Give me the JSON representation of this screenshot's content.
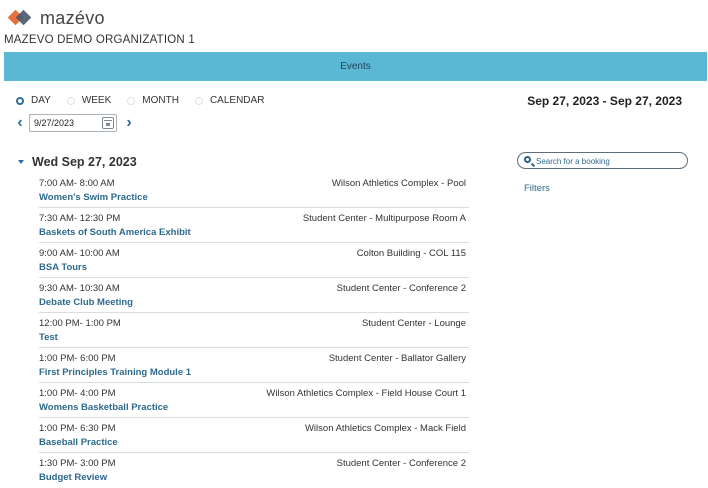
{
  "brand": {
    "name": "mazévo"
  },
  "organization": "MAZEVO DEMO ORGANIZATION 1",
  "tabs": [
    {
      "label": "Events",
      "active": true
    }
  ],
  "view_options": [
    {
      "label": "DAY",
      "selected": true
    },
    {
      "label": "WEEK",
      "selected": false
    },
    {
      "label": "MONTH",
      "selected": false
    },
    {
      "label": "CALENDAR",
      "selected": false
    }
  ],
  "date_range": "Sep 27, 2023 - Sep 27, 2023",
  "date_picker": {
    "value": "9/27/2023"
  },
  "day_header": "Wed Sep 27, 2023",
  "search": {
    "placeholder": "Search for a booking"
  },
  "filters_label": "Filters",
  "events": [
    {
      "time": "7:00 AM- 8:00 AM",
      "location": "Wilson Athletics Complex - Pool",
      "title": "Women's Swim Practice"
    },
    {
      "time": "7:30 AM- 12:30 PM",
      "location": "Student Center - Multipurpose Room A",
      "title": "Baskets of South America Exhibit"
    },
    {
      "time": "9:00 AM- 10:00 AM",
      "location": "Colton Building - COL 115",
      "title": "BSA Tours"
    },
    {
      "time": "9:30 AM- 10:30 AM",
      "location": "Student Center - Conference 2",
      "title": "Debate Club Meeting"
    },
    {
      "time": "12:00 PM- 1:00 PM",
      "location": "Student Center - Lounge",
      "title": "Test"
    },
    {
      "time": "1:00 PM- 6:00 PM",
      "location": "Student Center - Ballator Gallery",
      "title": "First Principles Training Module 1"
    },
    {
      "time": "1:00 PM- 4:00 PM",
      "location": "Wilson Athletics Complex - Field House Court 1",
      "title": "Womens Basketball Practice"
    },
    {
      "time": "1:00 PM- 6:30 PM",
      "location": "Wilson Athletics Complex - Mack Field",
      "title": "Baseball Practice"
    },
    {
      "time": "1:30 PM- 3:00 PM",
      "location": "Student Center - Conference 2",
      "title": "Budget Review"
    }
  ],
  "colors": {
    "accent": "#5bb8d4",
    "link": "#2d6a8d",
    "radio_selected": "#2f6e97"
  },
  "icons": {
    "prev": "chevron-left-icon",
    "next": "chevron-right-icon",
    "calendar": "calendar-icon",
    "search": "search-icon",
    "collapse": "caret-down-icon"
  }
}
